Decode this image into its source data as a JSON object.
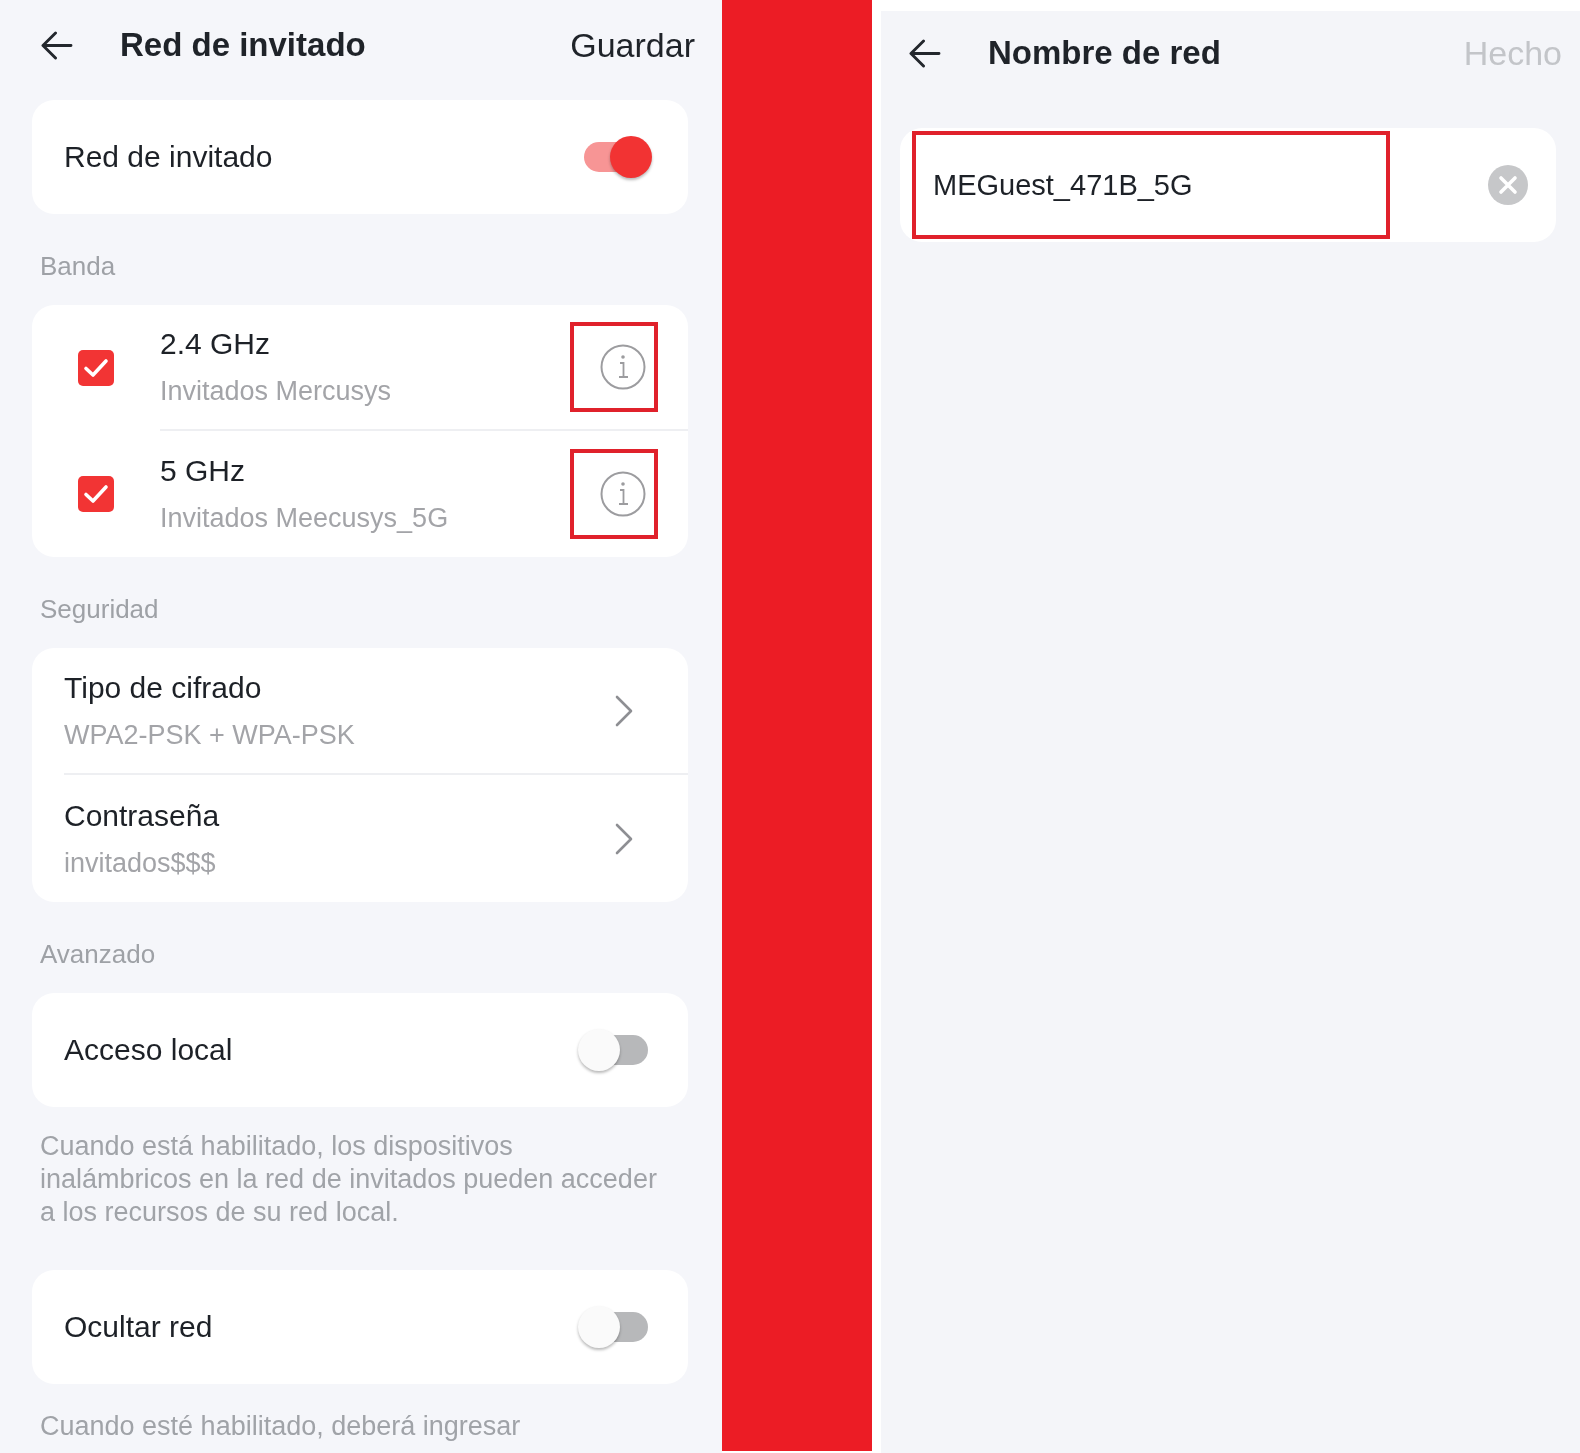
{
  "guest_network_screen": {
    "header": {
      "title": "Red de invitado",
      "action": "Guardar",
      "action_disabled": false
    },
    "guest_network": {
      "label": "Red de invitado",
      "on": true
    },
    "band": {
      "heading": "Banda",
      "items": [
        {
          "name": "2.4 GHz",
          "ssid": "Invitados Mercusys",
          "checked": true,
          "highlighted": true
        },
        {
          "name": "5 GHz",
          "ssid": "Invitados Meecusys_5G",
          "checked": true,
          "highlighted": true
        }
      ]
    },
    "security": {
      "heading": "Seguridad",
      "items": [
        {
          "label": "Tipo de cifrado",
          "value": "WPA2-PSK + WPA-PSK"
        },
        {
          "label": "Contraseña",
          "value": "invitados$$$"
        }
      ]
    },
    "advanced": {
      "heading": "Avanzado",
      "items": [
        {
          "label": "Acceso local",
          "on": false,
          "description": "Cuando está habilitado, los dispositivos inalámbricos en la red de invitados pueden acceder a los recursos de su red local."
        },
        {
          "label": "Ocultar red",
          "on": false,
          "description": "Cuando esté habilitado, deberá ingresar"
        }
      ]
    }
  },
  "network_name_screen": {
    "header": {
      "title": "Nombre de red",
      "action": "Hecho",
      "action_disabled": true
    },
    "field": {
      "value": "MEGuest_471B_5G",
      "highlighted": true
    }
  }
}
